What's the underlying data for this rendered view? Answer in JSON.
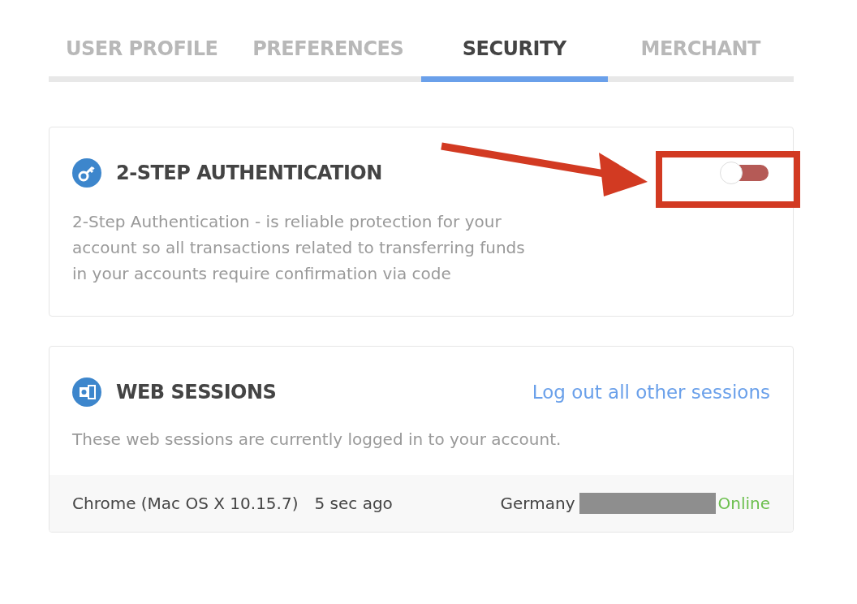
{
  "tabs": [
    {
      "label": "USER PROFILE",
      "selected": false
    },
    {
      "label": "PREFERENCES",
      "selected": false
    },
    {
      "label": "SECURITY",
      "selected": true
    },
    {
      "label": "MERCHANT",
      "selected": false
    }
  ],
  "two_step": {
    "title": "2-STEP AUTHENTICATION",
    "on": false,
    "description": "2-Step Authentication - is reliable protection for your account so all transactions related to transferring funds in your accounts require confirmation via code"
  },
  "web_sessions": {
    "title": "WEB SESSIONS",
    "logout_link": "Log out all other sessions",
    "description": "These web sessions are currently logged in to your account.",
    "sessions": [
      {
        "browser": "Chrome (Mac OS X 10.15.7)",
        "time": "5 sec ago",
        "country": "Germany",
        "status": "Online"
      }
    ]
  }
}
